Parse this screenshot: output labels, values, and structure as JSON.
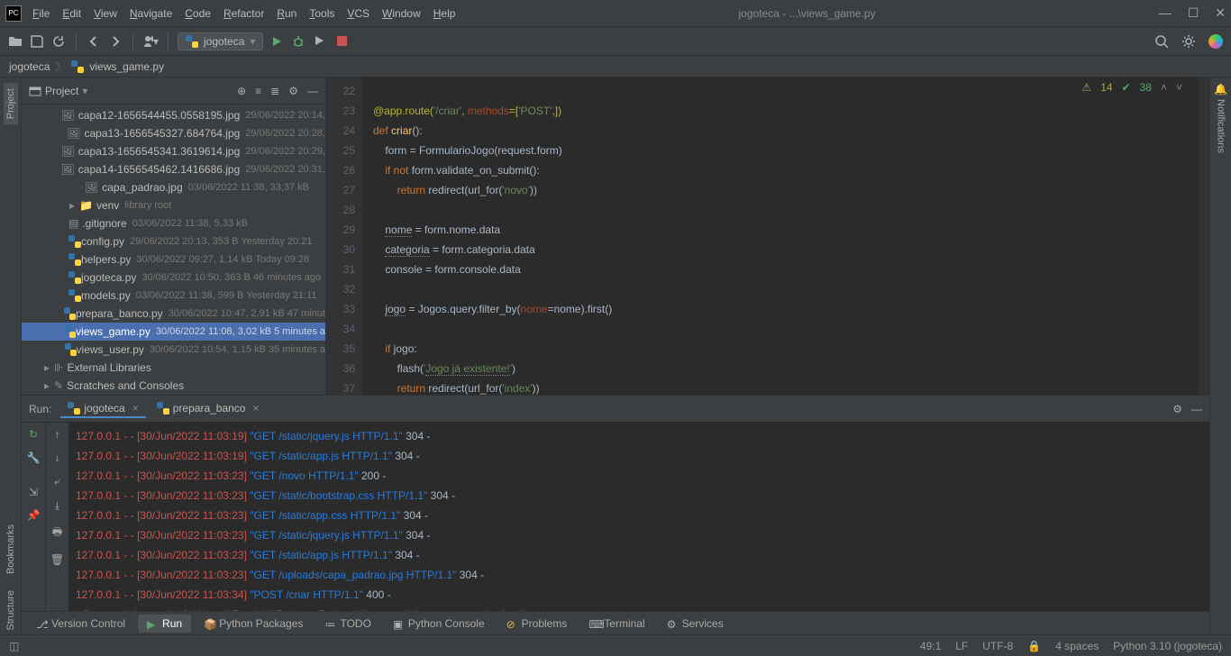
{
  "window": {
    "title": "jogoteca - ...\\views_game.py"
  },
  "menu": [
    "File",
    "Edit",
    "View",
    "Navigate",
    "Code",
    "Refactor",
    "Run",
    "Tools",
    "VCS",
    "Window",
    "Help"
  ],
  "toolbar": {
    "run_config": "jogoteca"
  },
  "breadcrumb": {
    "root": "jogoteca",
    "file": "views_game.py"
  },
  "project_panel": {
    "title": "Project"
  },
  "tree": [
    {
      "indent": 64,
      "icon": "img",
      "name": "capa12-1656544455.0558195.jpg",
      "meta": "29/06/2022 20:14,"
    },
    {
      "indent": 64,
      "icon": "img",
      "name": "capa13-1656545327.684764.jpg",
      "meta": "29/06/2022 20:28, "
    },
    {
      "indent": 64,
      "icon": "img",
      "name": "capa13-1656545341.3619614.jpg",
      "meta": "29/06/2022 20:29,"
    },
    {
      "indent": 64,
      "icon": "img",
      "name": "capa14-1656545462.1416686.jpg",
      "meta": "29/06/2022 20:31,"
    },
    {
      "indent": 64,
      "icon": "img",
      "name": "capa_padrao.jpg",
      "meta": "03/06/2022 11:38, 33,37 kB"
    },
    {
      "indent": 44,
      "icon": "folder",
      "name": "venv",
      "meta": "library root",
      "expand": "▸"
    },
    {
      "indent": 46,
      "icon": "txt",
      "name": ".gitignore",
      "meta": "03/06/2022 11:38, 5,33 kB"
    },
    {
      "indent": 46,
      "icon": "py",
      "name": "config.py",
      "meta": "29/06/2022 20:13, 353 B Yesterday 20:21"
    },
    {
      "indent": 46,
      "icon": "py",
      "name": "helpers.py",
      "meta": "30/06/2022 09:27, 1,14 kB Today 09:28"
    },
    {
      "indent": 46,
      "icon": "py",
      "name": "jogoteca.py",
      "meta": "30/06/2022 10:50, 363 B 46 minutes ago"
    },
    {
      "indent": 46,
      "icon": "py",
      "name": "models.py",
      "meta": "03/06/2022 11:38, 599 B Yesterday 21:11"
    },
    {
      "indent": 46,
      "icon": "py",
      "name": "prepara_banco.py",
      "meta": "30/06/2022 10:47, 2,91 kB 47 minut"
    },
    {
      "indent": 46,
      "icon": "py",
      "name": "views_game.py",
      "meta": "30/06/2022 11:08, 3,02 kB 5 minutes a",
      "selected": true
    },
    {
      "indent": 46,
      "icon": "py",
      "name": "views_user.py",
      "meta": "30/06/2022 10:54, 1,15 kB 35 minutes a"
    },
    {
      "indent": 16,
      "icon": "lib",
      "name": "External Libraries",
      "expand": "▸"
    },
    {
      "indent": 16,
      "icon": "scratch",
      "name": "Scratches and Consoles",
      "expand": "▸"
    }
  ],
  "editor": {
    "first_line": 22,
    "inspection": {
      "warn_count": "14",
      "ok_count": "38"
    },
    "lines": [
      "",
      "@app.route(<s>'/criar'</s>, <par>methods</par>=[<s>'POST'</s>,])",
      "<k>def</k> <fn>criar</fn>():",
      "    form = FormularioJogo(request.form)",
      "    <k>if not</k> form.validate_on_submit():",
      "        <k>return</k> redirect(url_for(<s>'novo'</s>))",
      "",
      "    <u>nome</u> = form.nome.data",
      "    <u>categoria</u> = form.categoria.data",
      "    console = form.console.data",
      "",
      "    <u>jogo</u> = Jogos.query.filter_by(<par>nome</par>=nome).first()",
      "",
      "    <k>if</k> jogo:",
      "        flash(<s>'<u>Jogo já existente!</u>'</s>)",
      "        <k>return</k> redirect(url_for(<s>'index'</s>))",
      ""
    ]
  },
  "run": {
    "label": "Run:",
    "tabs": [
      {
        "name": "jogoteca",
        "active": true
      },
      {
        "name": "prepara_banco",
        "active": false
      }
    ],
    "logs": [
      {
        "ip": "127.0.0.1 - -",
        "date": "[30/Jun/2022 11:03:19]",
        "req": "\"GET /static/jquery.js HTTP/1.1\"",
        "code": "304 -"
      },
      {
        "ip": "127.0.0.1 - -",
        "date": "[30/Jun/2022 11:03:19]",
        "req": "\"GET /static/app.js HTTP/1.1\"",
        "code": "304 -"
      },
      {
        "ip": "127.0.0.1 - -",
        "date": "[30/Jun/2022 11:03:23]",
        "req": "\"GET /novo HTTP/1.1\"",
        "code": "200 -"
      },
      {
        "ip": "127.0.0.1 - -",
        "date": "[30/Jun/2022 11:03:23]",
        "req": "\"GET /static/bootstrap.css HTTP/1.1\"",
        "code": "304 -"
      },
      {
        "ip": "127.0.0.1 - -",
        "date": "[30/Jun/2022 11:03:23]",
        "req": "\"GET /static/app.css HTTP/1.1\"",
        "code": "304 -"
      },
      {
        "ip": "127.0.0.1 - -",
        "date": "[30/Jun/2022 11:03:23]",
        "req": "\"GET /static/jquery.js HTTP/1.1\"",
        "code": "304 -"
      },
      {
        "ip": "127.0.0.1 - -",
        "date": "[30/Jun/2022 11:03:23]",
        "req": "\"GET /static/app.js HTTP/1.1\"",
        "code": "304 -"
      },
      {
        "ip": "127.0.0.1 - -",
        "date": "[30/Jun/2022 11:03:23]",
        "req": "\"GET /uploads/capa_padrao.jpg HTTP/1.1\"",
        "code": "304 -"
      },
      {
        "ip": "127.0.0.1 - -",
        "date": "[30/Jun/2022 11:03:34]",
        "req": "\"POST /criar HTTP/1.1\"",
        "code": "400 -"
      }
    ],
    "reload": " * Detected change in 'C:\\\\Users\\\\Rogério\\\\PycharmProjects\\\\jogoteca\\\\views_game.py', reloading"
  },
  "bottom_tabs": [
    {
      "icon": "vcs",
      "label": "Version Control"
    },
    {
      "icon": "run",
      "label": "Run",
      "active": true
    },
    {
      "icon": "pkg",
      "label": "Python Packages"
    },
    {
      "icon": "todo",
      "label": "TODO"
    },
    {
      "icon": "pyc",
      "label": "Python Console"
    },
    {
      "icon": "prob",
      "label": "Problems"
    },
    {
      "icon": "term",
      "label": "Terminal"
    },
    {
      "icon": "svc",
      "label": "Services"
    }
  ],
  "status": {
    "pos": "49:1",
    "le": "LF",
    "enc": "UTF-8",
    "indent": "4 spaces",
    "interp": "Python 3.10 (jogoteca)"
  },
  "left_tabs": [
    "Project",
    "Bookmarks",
    "Structure"
  ],
  "right_tabs": [
    "Notifications"
  ]
}
